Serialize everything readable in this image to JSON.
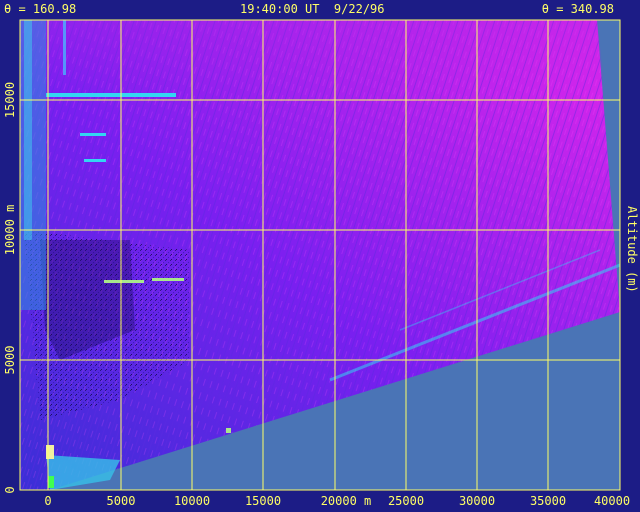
{
  "header": {
    "left": "θ = 160.98",
    "center": "19:40:00 UT  9/22/96",
    "right": "θ = 340.98"
  },
  "x_axis": {
    "ticks": [
      "0",
      "5000",
      "10000",
      "15000",
      "20000 m",
      "25000",
      "30000",
      "35000",
      "40000"
    ]
  },
  "y_axis": {
    "ticks": [
      "0",
      "5000",
      "10000 m",
      "15000"
    ]
  },
  "right_label": "Altitude (m)",
  "colors": {
    "background": "#1c1c86",
    "no_data": "#4a74b6",
    "grid": "#ffff66",
    "scan_low": "#3f2ad8",
    "scan_high": "#e023e8",
    "echo": "#2fd8f0"
  }
}
